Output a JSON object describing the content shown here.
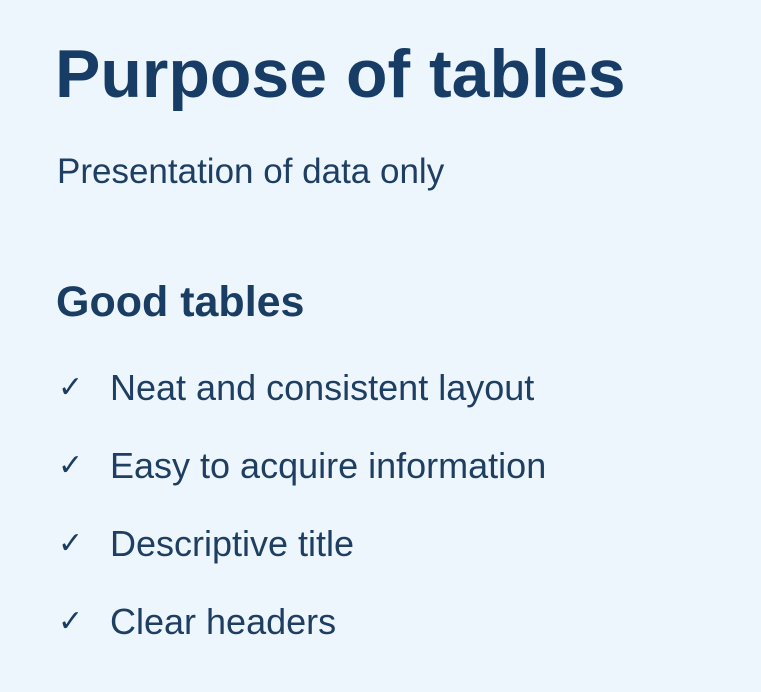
{
  "slide": {
    "title": "Purpose of tables",
    "subtitle": "Presentation of data only",
    "section_heading": "Good tables",
    "checklist": [
      {
        "icon": "check-icon",
        "label": "Neat and consistent layout"
      },
      {
        "icon": "check-icon",
        "label": "Easy to acquire information"
      },
      {
        "icon": "check-icon",
        "label": "Descriptive title"
      },
      {
        "icon": "check-icon",
        "label": "Clear headers"
      }
    ]
  },
  "colors": {
    "background": "#eef6fd",
    "heading": "#173d66",
    "text": "#1e3e62"
  }
}
